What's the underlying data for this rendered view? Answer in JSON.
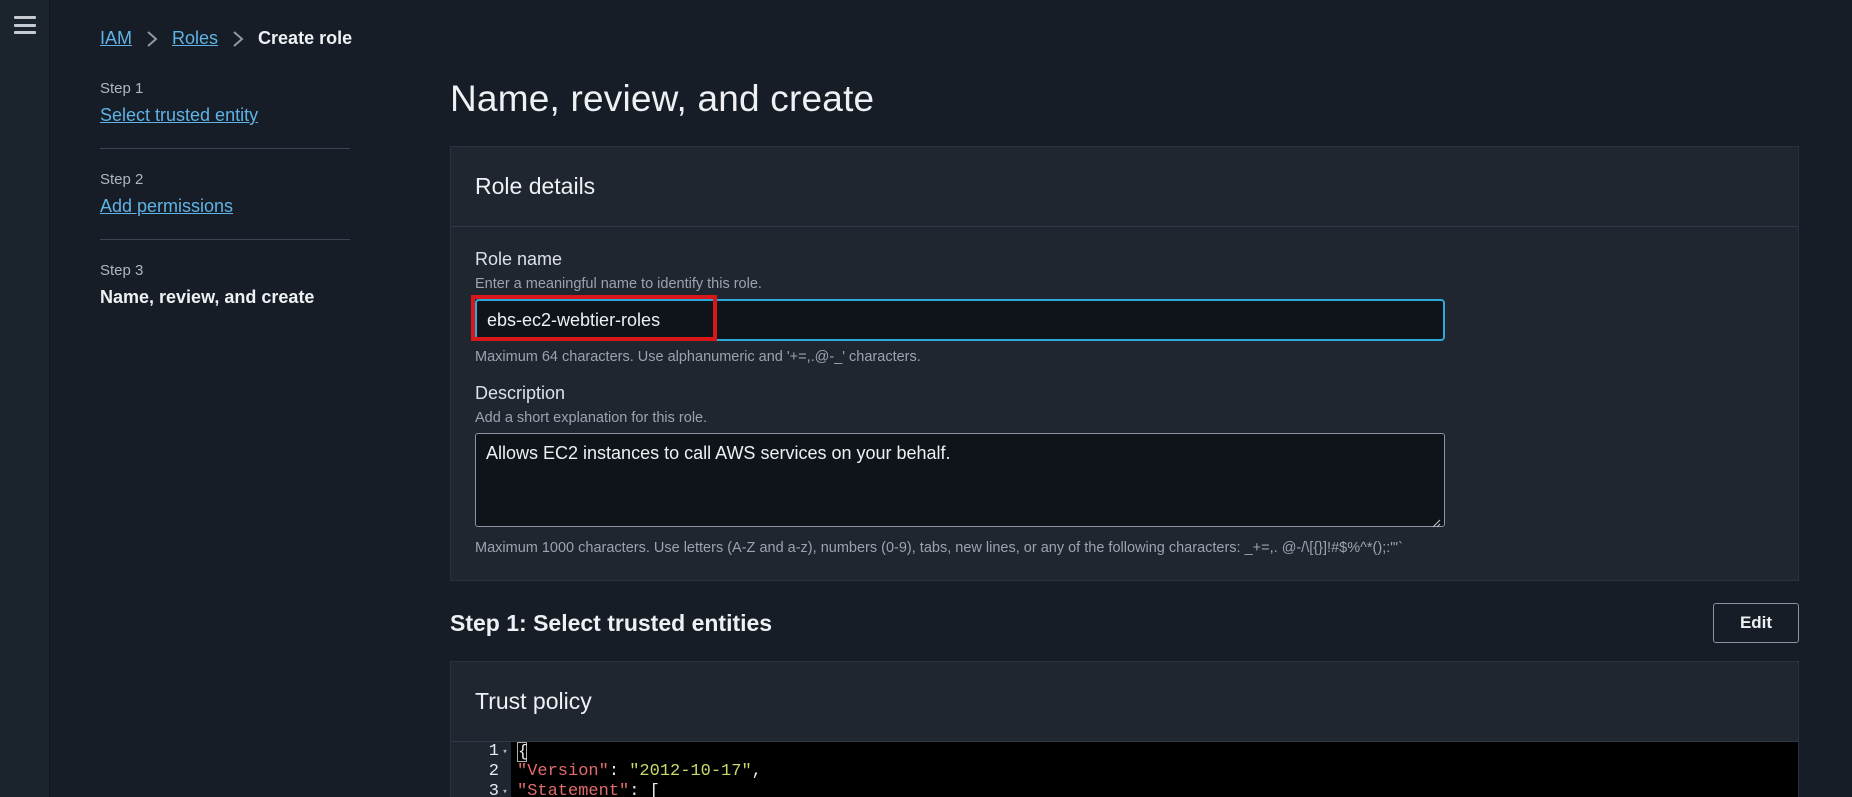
{
  "breadcrumb": {
    "items": [
      "IAM",
      "Roles"
    ],
    "current": "Create role"
  },
  "steps": [
    {
      "number": "Step 1",
      "label": "Select trusted entity"
    },
    {
      "number": "Step 2",
      "label": "Add permissions"
    },
    {
      "number": "Step 3",
      "label": "Name, review, and create"
    }
  ],
  "page": {
    "title": "Name, review, and create"
  },
  "role_details": {
    "header": "Role details",
    "role_name": {
      "label": "Role name",
      "hint": "Enter a meaningful name to identify this role.",
      "value": "ebs-ec2-webtier-roles",
      "constraint": "Maximum 64 characters. Use alphanumeric and '+=,.@-_' characters."
    },
    "description": {
      "label": "Description",
      "hint": "Add a short explanation for this role.",
      "value": "Allows EC2 instances to call AWS services on your behalf.",
      "constraint": "Maximum 1000 characters. Use letters (A-Z and a-z), numbers (0-9), tabs, new lines, or any of the following characters: _+=,. @-/\\[{}]!#$%^*();:\"'`"
    }
  },
  "step1_section": {
    "title": "Step 1: Select trusted entities",
    "edit_label": "Edit"
  },
  "trust_policy": {
    "header": "Trust policy",
    "lines": [
      {
        "no": "1",
        "fold": true
      },
      {
        "no": "2",
        "fold": false,
        "key": "\"Version\"",
        "value": "\"2012-10-17\""
      },
      {
        "no": "3",
        "fold": true,
        "key": "\"Statement\"",
        "value": "["
      }
    ]
  },
  "colors": {
    "accent": "#2ea8d8",
    "link": "#5fb3e6",
    "highlight": "#d81818"
  }
}
